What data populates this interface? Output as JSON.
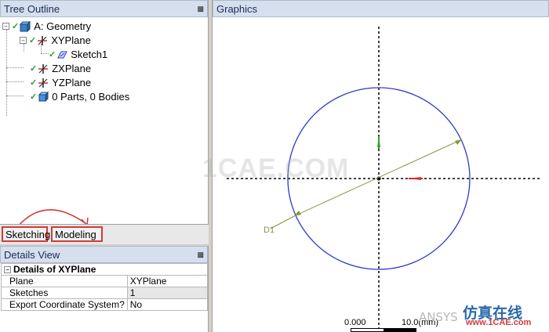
{
  "tree_outline": {
    "title": "Tree Outline",
    "items": [
      {
        "label": "A: Geometry",
        "icon": "geometry-icon"
      },
      {
        "label": "XYPlane",
        "icon": "plane-axes-icon"
      },
      {
        "label": "Sketch1",
        "icon": "sketch-icon"
      },
      {
        "label": "ZXPlane",
        "icon": "plane-axes-icon"
      },
      {
        "label": "YZPlane",
        "icon": "plane-axes-icon"
      },
      {
        "label": "0 Parts, 0 Bodies",
        "icon": "parts-bodies-icon"
      }
    ]
  },
  "tabs": {
    "sketching": "Sketching",
    "modeling": "Modeling"
  },
  "details_view": {
    "title": "Details View",
    "group": "Details of XYPlane",
    "rows": [
      {
        "key": "Plane",
        "value": "XYPlane"
      },
      {
        "key": "Sketches",
        "value": "1"
      },
      {
        "key": "Export Coordinate System?",
        "value": "No"
      }
    ]
  },
  "graphics": {
    "title": "Graphics",
    "dimension_label": "D1",
    "scale_left": "0.000",
    "scale_right": "10.0(mm)",
    "watermark": "1CAE.COM",
    "brand_text": "仿真在线",
    "brand_url": "www.1CAE.com",
    "ansys_mark": "ANSYS"
  },
  "colors": {
    "circle": "#2b3ac8",
    "dimension": "#7f9a3a",
    "axis_x": "#d03030",
    "axis_y": "#30a030",
    "highlight_box": "#d23a3a"
  }
}
